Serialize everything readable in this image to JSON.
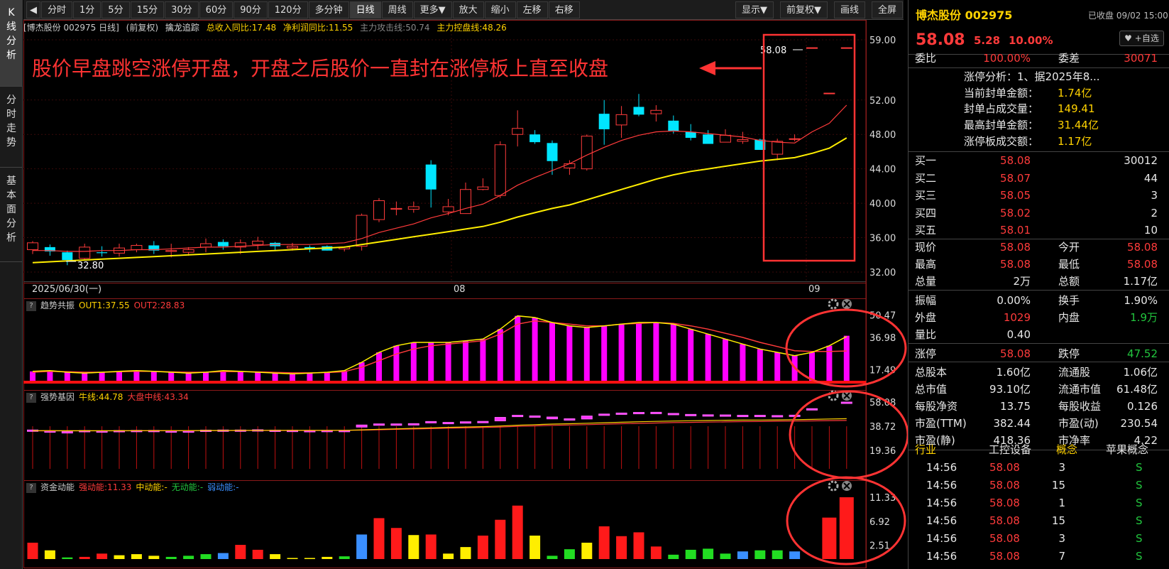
{
  "left_tabs": [
    "K线分析",
    "分时走势",
    "基本面分析"
  ],
  "toolbar": {
    "prev": "◀",
    "periods": [
      "分时",
      "1分",
      "5分",
      "15分",
      "30分",
      "60分",
      "90分",
      "120分",
      "多分钟",
      "日线",
      "周线",
      "更多▼",
      "放大",
      "缩小",
      "左移",
      "右移"
    ],
    "active": "日线",
    "right": [
      "显示▼",
      "前复权▼",
      "画线",
      "全屏"
    ]
  },
  "info": {
    "name": "[博杰股份 002975 日线]",
    "fq": "(前复权)",
    "indicator": "擒龙追踪",
    "i1": "总收入同比:17.48",
    "i2": "净利润同比:11.55",
    "i3": "主力攻击线:50.74",
    "i4": "主力控盘线:48.26"
  },
  "annotation": "股价早盘跳空涨停开盘，开盘之后股价一直封在涨停板上直至收盘",
  "price_axis": [
    "59.00",
    "52.00",
    "48.00",
    "44.00",
    "40.00",
    "36.00",
    "32.00"
  ],
  "x_labels": [
    "2025/06/30(一)",
    "08",
    "09"
  ],
  "last_price_tag": "58.08",
  "low_tag": "32.80",
  "colors": {
    "up": "#ff3b3b",
    "down": "#00e5ff",
    "ma1": "#ff3b3b",
    "ma2": "#ffee00",
    "magenta": "#ff00ff"
  },
  "chart_data": {
    "type": "candlestick",
    "ohlc": [
      [
        34.6,
        35.6,
        34.1,
        35.4
      ],
      [
        34.9,
        35.2,
        33.9,
        34.4
      ],
      [
        34.3,
        34.5,
        32.8,
        33.4
      ],
      [
        33.6,
        35.3,
        33.5,
        34.9
      ],
      [
        34.3,
        35.0,
        33.8,
        34.2
      ],
      [
        34.2,
        35.3,
        33.8,
        34.8
      ],
      [
        34.6,
        35.3,
        34.3,
        35.1
      ],
      [
        35.1,
        35.6,
        34.1,
        34.5
      ],
      [
        34.4,
        35.3,
        33.7,
        34.5
      ],
      [
        34.3,
        34.9,
        33.9,
        34.6
      ],
      [
        34.9,
        35.9,
        34.3,
        35.3
      ],
      [
        35.5,
        35.8,
        34.6,
        35.0
      ],
      [
        34.9,
        35.8,
        34.1,
        35.4
      ],
      [
        35.2,
        36.1,
        34.6,
        35.6
      ],
      [
        35.4,
        35.5,
        34.5,
        35.0
      ],
      [
        34.8,
        35.4,
        34.5,
        35.0
      ],
      [
        34.9,
        35.1,
        34.3,
        34.7
      ],
      [
        35.0,
        35.1,
        34.5,
        34.5
      ],
      [
        34.7,
        35.0,
        34.4,
        34.9
      ],
      [
        35.0,
        38.8,
        34.5,
        38.6
      ],
      [
        38.1,
        40.6,
        37.8,
        40.3
      ],
      [
        39.3,
        40.2,
        38.6,
        39.4
      ],
      [
        39.3,
        40.2,
        38.9,
        39.6
      ],
      [
        44.5,
        45.0,
        39.5,
        41.6
      ],
      [
        39.0,
        40.5,
        38.6,
        39.6
      ],
      [
        38.8,
        42.4,
        38.8,
        41.6
      ],
      [
        41.6,
        42.9,
        41.5,
        41.9
      ],
      [
        40.9,
        47.2,
        40.6,
        46.8
      ],
      [
        48.0,
        50.8,
        46.6,
        48.7
      ],
      [
        48.0,
        48.5,
        46.9,
        47.1
      ],
      [
        47.0,
        47.3,
        43.3,
        44.9
      ],
      [
        44.1,
        45.0,
        43.3,
        44.6
      ],
      [
        44.0,
        48.0,
        43.8,
        47.8
      ],
      [
        50.4,
        52.0,
        46.8,
        48.6
      ],
      [
        49.1,
        51.3,
        47.6,
        50.3
      ],
      [
        51.2,
        52.7,
        50.1,
        50.3
      ],
      [
        50.4,
        51.4,
        49.5,
        50.8
      ],
      [
        49.6,
        50.2,
        48.1,
        48.4
      ],
      [
        48.3,
        49.2,
        47.3,
        47.6
      ],
      [
        48.0,
        48.5,
        47.0,
        46.9
      ],
      [
        47.1,
        48.6,
        47.1,
        47.9
      ],
      [
        47.2,
        48.3,
        46.9,
        47.4
      ],
      [
        47.4,
        47.5,
        46.4,
        46.2
      ],
      [
        45.7,
        47.5,
        45.0,
        47.2
      ],
      [
        47.5,
        48.0,
        47.2,
        47.5
      ],
      [
        58.08,
        58.08,
        58.08,
        58.08
      ],
      [
        52.8,
        52.8,
        52.8,
        52.8
      ],
      [
        58.08,
        58.08,
        58.08,
        58.08
      ]
    ],
    "ma_red": [
      34.5,
      34.5,
      34.4,
      34.4,
      34.5,
      34.5,
      34.6,
      34.6,
      34.7,
      34.8,
      34.9,
      34.9,
      35.0,
      35.1,
      35.2,
      35.2,
      35.2,
      35.3,
      35.4,
      35.9,
      36.6,
      37.1,
      37.6,
      38.3,
      38.8,
      39.4,
      39.9,
      40.9,
      42.1,
      43.0,
      43.8,
      44.6,
      45.6,
      46.5,
      47.3,
      47.9,
      48.3,
      48.4,
      48.3,
      48.1,
      47.9,
      47.7,
      47.3,
      47.1,
      47.0,
      48.3,
      49.3,
      51.4
    ],
    "ma_yellow": [
      33.1,
      33.2,
      33.3,
      33.4,
      33.5,
      33.6,
      33.7,
      33.8,
      33.9,
      34.0,
      34.1,
      34.2,
      34.3,
      34.4,
      34.5,
      34.6,
      34.7,
      34.8,
      34.9,
      35.2,
      35.5,
      35.8,
      36.1,
      36.4,
      36.7,
      37.0,
      37.3,
      37.8,
      38.4,
      38.9,
      39.4,
      39.8,
      40.4,
      41.0,
      41.6,
      42.2,
      42.8,
      43.3,
      43.7,
      44.0,
      44.3,
      44.6,
      44.9,
      45.1,
      45.3,
      45.8,
      46.4,
      47.6
    ]
  },
  "ind1": {
    "name": "趋势共振",
    "out1": "OUT1:37.55",
    "out2": "OUT2:28.83",
    "axis": [
      "50.47",
      "36.98",
      "17.49"
    ],
    "values": [
      16.5,
      17,
      16,
      15.5,
      16,
      16.5,
      17,
      16.5,
      16,
      15.5,
      16,
      17,
      16.5,
      16,
      15.5,
      15,
      15.5,
      16,
      17,
      22,
      28,
      32,
      34,
      34,
      34,
      35,
      36,
      42,
      50,
      49,
      46,
      44,
      43,
      44,
      45,
      46,
      46,
      45,
      42,
      39,
      36,
      33,
      30,
      28,
      26,
      28,
      32,
      38
    ],
    "out1_line": [
      16.5,
      17,
      16,
      15.5,
      16,
      16.5,
      17,
      16.5,
      16,
      15.5,
      16,
      17,
      16.5,
      16,
      15.5,
      15,
      15.5,
      16,
      17,
      22,
      28,
      32,
      34,
      34,
      34,
      35,
      36,
      42,
      50,
      49,
      46,
      44,
      43,
      44,
      45,
      46,
      46,
      45,
      42,
      39,
      36,
      33,
      30,
      28,
      26,
      28,
      32,
      37.55
    ],
    "out2_line": [
      16,
      16.5,
      16.3,
      16,
      16,
      16.3,
      16.6,
      16.5,
      16.2,
      16,
      16,
      16.4,
      16.4,
      16.2,
      15.9,
      15.6,
      15.6,
      15.8,
      16.3,
      19,
      23,
      27,
      30,
      32,
      33,
      34,
      35,
      39,
      45,
      47,
      46,
      45,
      44,
      44,
      45,
      45.5,
      46,
      45.5,
      44,
      42,
      39.5,
      37,
      34,
      31.5,
      29,
      28.5,
      28.5,
      28.83
    ]
  },
  "ind2": {
    "name": "强势基因",
    "l1": "牛线:44.78",
    "l2": "大盘中线:43.34",
    "axis": [
      "58.08",
      "38.72",
      "19.36"
    ],
    "ohlc": [
      [
        35.3,
        35.8,
        34.7,
        35.7
      ],
      [
        35.0,
        35.4,
        34.5,
        34.8
      ],
      [
        34.4,
        34.7,
        34.1,
        34.2
      ],
      [
        34.7,
        35.5,
        34.5,
        35.3
      ],
      [
        34.9,
        35.4,
        34.6,
        35.0
      ],
      [
        35.0,
        35.7,
        34.8,
        35.3
      ],
      [
        35.2,
        35.7,
        35.0,
        35.4
      ],
      [
        35.4,
        35.7,
        34.8,
        35.0
      ],
      [
        34.9,
        35.4,
        34.6,
        35.0
      ],
      [
        34.9,
        35.2,
        34.7,
        35.0
      ],
      [
        35.3,
        36.0,
        35.0,
        35.6
      ],
      [
        35.7,
        36.1,
        35.3,
        35.5
      ],
      [
        35.4,
        36.0,
        35.0,
        35.7
      ],
      [
        35.7,
        36.2,
        35.5,
        35.9
      ],
      [
        35.6,
        35.8,
        35.3,
        35.3
      ],
      [
        35.5,
        35.8,
        35.3,
        35.4
      ],
      [
        35.3,
        35.6,
        35.1,
        35.2
      ],
      [
        35.4,
        35.5,
        35.1,
        35.1
      ],
      [
        35.2,
        35.4,
        35.0,
        35.4
      ],
      [
        38.0,
        39.9,
        37.5,
        39.7
      ],
      [
        40.0,
        41.0,
        39.5,
        40.6
      ],
      [
        40.5,
        41.2,
        40.0,
        40.6
      ],
      [
        40.5,
        41.2,
        40.0,
        40.8
      ],
      [
        42.5,
        43.0,
        41.2,
        41.6
      ],
      [
        41.8,
        42.3,
        41.0,
        41.4
      ],
      [
        41.4,
        42.6,
        41.3,
        42.3
      ],
      [
        42.3,
        42.9,
        42.2,
        42.6
      ],
      [
        43.0,
        46.0,
        42.8,
        45.8
      ],
      [
        46.8,
        48.5,
        46.0,
        47.5
      ],
      [
        47.0,
        47.5,
        46.0,
        46.2
      ],
      [
        46.1,
        46.2,
        44.0,
        44.6
      ],
      [
        44.5,
        45.2,
        44.0,
        44.7
      ],
      [
        44.5,
        47.0,
        44.4,
        46.9
      ],
      [
        48.5,
        49.5,
        46.8,
        47.8
      ],
      [
        48.4,
        50.0,
        47.7,
        49.3
      ],
      [
        49.6,
        51.0,
        49.2,
        49.8
      ],
      [
        49.7,
        50.3,
        49.2,
        49.9
      ],
      [
        49.0,
        49.3,
        48.2,
        48.3
      ],
      [
        48.2,
        48.7,
        47.6,
        47.7
      ],
      [
        47.9,
        48.1,
        47.2,
        47.1
      ],
      [
        47.3,
        48.0,
        47.2,
        47.8
      ],
      [
        47.4,
        47.9,
        47.2,
        47.5
      ],
      [
        47.5,
        47.6,
        46.8,
        46.7
      ],
      [
        46.4,
        47.4,
        46.0,
        47.3
      ],
      [
        47.4,
        47.8,
        47.3,
        47.6
      ],
      [
        52.8,
        52.8,
        52.8,
        52.8
      ],
      [
        null,
        null,
        null,
        null
      ],
      [
        58.08,
        58.08,
        58.08,
        58.08
      ]
    ],
    "bull": [
      35.2,
      35.2,
      35.1,
      35.1,
      35.1,
      35.1,
      35.2,
      35.2,
      35.2,
      35.2,
      35.3,
      35.3,
      35.4,
      35.4,
      35.4,
      35.4,
      35.4,
      35.4,
      35.4,
      35.8,
      36.2,
      36.6,
      37.0,
      37.4,
      37.8,
      38.1,
      38.4,
      38.9,
      39.5,
      40.0,
      40.4,
      40.7,
      41.1,
      41.5,
      41.9,
      42.3,
      42.6,
      42.9,
      43.1,
      43.3,
      43.5,
      43.6,
      43.7,
      43.8,
      43.9,
      44.2,
      44.5,
      44.78
    ],
    "dpzx": [
      35.0,
      35.0,
      35.0,
      35.0,
      35.0,
      35.0,
      35.1,
      35.1,
      35.1,
      35.1,
      35.2,
      35.2,
      35.2,
      35.3,
      35.3,
      35.3,
      35.3,
      35.3,
      35.4,
      35.6,
      35.9,
      36.2,
      36.5,
      36.8,
      37.1,
      37.4,
      37.7,
      38.1,
      38.6,
      39.0,
      39.4,
      39.7,
      40.0,
      40.3,
      40.7,
      41.0,
      41.3,
      41.6,
      41.8,
      42.0,
      42.2,
      42.4,
      42.5,
      42.7,
      42.8,
      43.0,
      43.2,
      43.34
    ]
  },
  "ind3": {
    "name": "资金动能",
    "l1": "强动能:11.33",
    "l2": "中动能:-",
    "l3": "无动能:-",
    "l4": "弱动能:-",
    "axis": [
      "11.33",
      "6.92",
      "2.51"
    ],
    "values": [
      3.0,
      1.6,
      0.3,
      0.4,
      1.0,
      0.7,
      0.9,
      0.6,
      0.4,
      0.6,
      0.9,
      1.1,
      2.6,
      1.7,
      0.9,
      0.2,
      0.2,
      0.4,
      0.5,
      4.5,
      7.5,
      5.7,
      4.4,
      4.5,
      1.0,
      2.2,
      4.3,
      7.2,
      9.8,
      4.3,
      0.6,
      1.8,
      3.0,
      6.0,
      4.2,
      4.9,
      2.3,
      0.8,
      1.7,
      1.9,
      1.0,
      1.4,
      1.6,
      1.6,
      1.4,
      0,
      7.6,
      11.33
    ],
    "cats": [
      "r",
      "y",
      "g",
      "r",
      "r",
      "y",
      "y",
      "y",
      "g",
      "g",
      "g",
      "b",
      "r",
      "r",
      "y",
      "y",
      "y",
      "y",
      "g",
      "b",
      "r",
      "r",
      "y",
      "r",
      "y",
      "y",
      "r",
      "r",
      "r",
      "y",
      "g",
      "g",
      "y",
      "r",
      "r",
      "r",
      "r",
      "g",
      "g",
      "g",
      "g",
      "b",
      "g",
      "g",
      "b",
      "n",
      "r",
      "r"
    ]
  },
  "quote": {
    "name": "博杰股份 002975",
    "status": "已收盘 09/02 15:00",
    "price": "58.08",
    "change": "5.28",
    "pct": "10.00%",
    "add": "+自选",
    "webi_label": "委比",
    "webi": "100.00%",
    "weicha_label": "委差",
    "weicha": "30071",
    "zt": [
      "涨停分析：1、据2025年8...",
      "当前封单金额：",
      "1.74亿",
      "封单占成交量：",
      "149.41",
      "最高封单金额：",
      "31.44亿",
      "涨停板成交额：",
      "1.17亿"
    ],
    "bids": [
      [
        "买一",
        "58.08",
        "30012"
      ],
      [
        "买二",
        "58.07",
        "44"
      ],
      [
        "买三",
        "58.05",
        "3"
      ],
      [
        "买四",
        "58.02",
        "2"
      ],
      [
        "买五",
        "58.01",
        "10"
      ]
    ],
    "stats": [
      [
        "现价",
        "58.08",
        "今开",
        "58.08"
      ],
      [
        "最高",
        "58.08",
        "最低",
        "58.08"
      ],
      [
        "总量",
        "2万",
        "总额",
        "1.17亿"
      ],
      [
        "振幅",
        "0.00%",
        "换手",
        "1.90%"
      ],
      [
        "外盘",
        "1029",
        "内盘",
        "1.9万"
      ],
      [
        "量比",
        "0.40",
        "",
        ""
      ],
      [
        "涨停",
        "58.08",
        "跌停",
        "47.52"
      ],
      [
        "总股本",
        "1.60亿",
        "流通股",
        "1.06亿"
      ],
      [
        "总市值",
        "93.10亿",
        "流通市值",
        "61.48亿"
      ],
      [
        "每股净资",
        "13.75",
        "每股收益",
        "0.126"
      ],
      [
        "市盈(TTM)",
        "382.44",
        "市盈(动)",
        "230.54"
      ],
      [
        "市盈(静)",
        "418.36",
        "市净率",
        "4.22"
      ]
    ],
    "industry": [
      "行业",
      "工控设备",
      "概念",
      "苹果概念"
    ],
    "ticks": [
      [
        "14:56",
        "58.08",
        "3",
        "S"
      ],
      [
        "14:56",
        "58.08",
        "15",
        "S"
      ],
      [
        "14:56",
        "58.08",
        "1",
        "S"
      ],
      [
        "14:56",
        "58.08",
        "15",
        "S"
      ],
      [
        "14:56",
        "58.08",
        "3",
        "S"
      ],
      [
        "14:56",
        "58.08",
        "7",
        "S"
      ]
    ]
  }
}
